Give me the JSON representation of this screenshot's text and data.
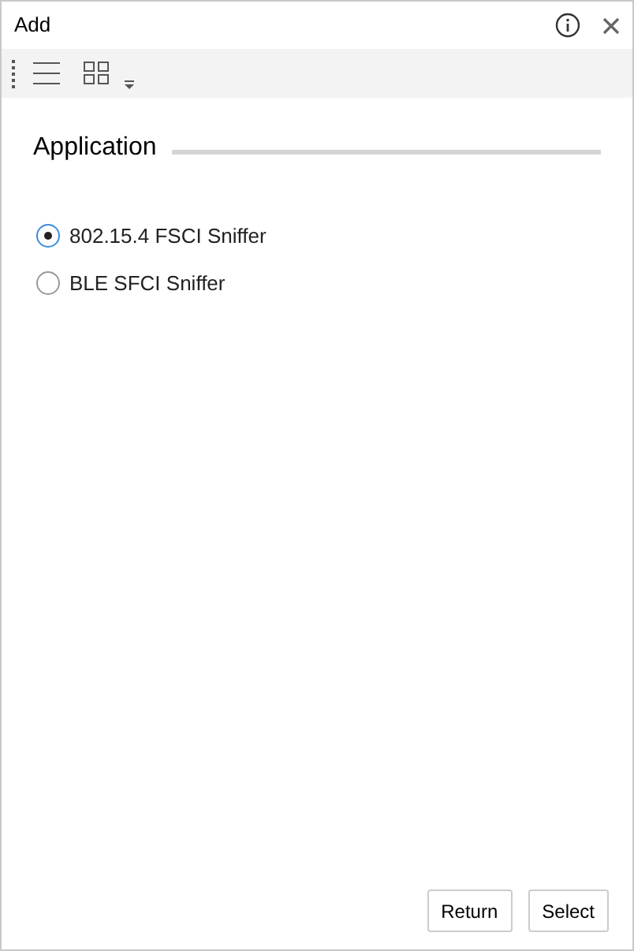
{
  "window": {
    "title": "Add"
  },
  "section": {
    "title": "Application"
  },
  "options": [
    {
      "label": "802.15.4 FSCI Sniffer",
      "selected": true
    },
    {
      "label": "BLE SFCI Sniffer",
      "selected": false
    }
  ],
  "buttons": [
    "Return",
    "Select"
  ]
}
